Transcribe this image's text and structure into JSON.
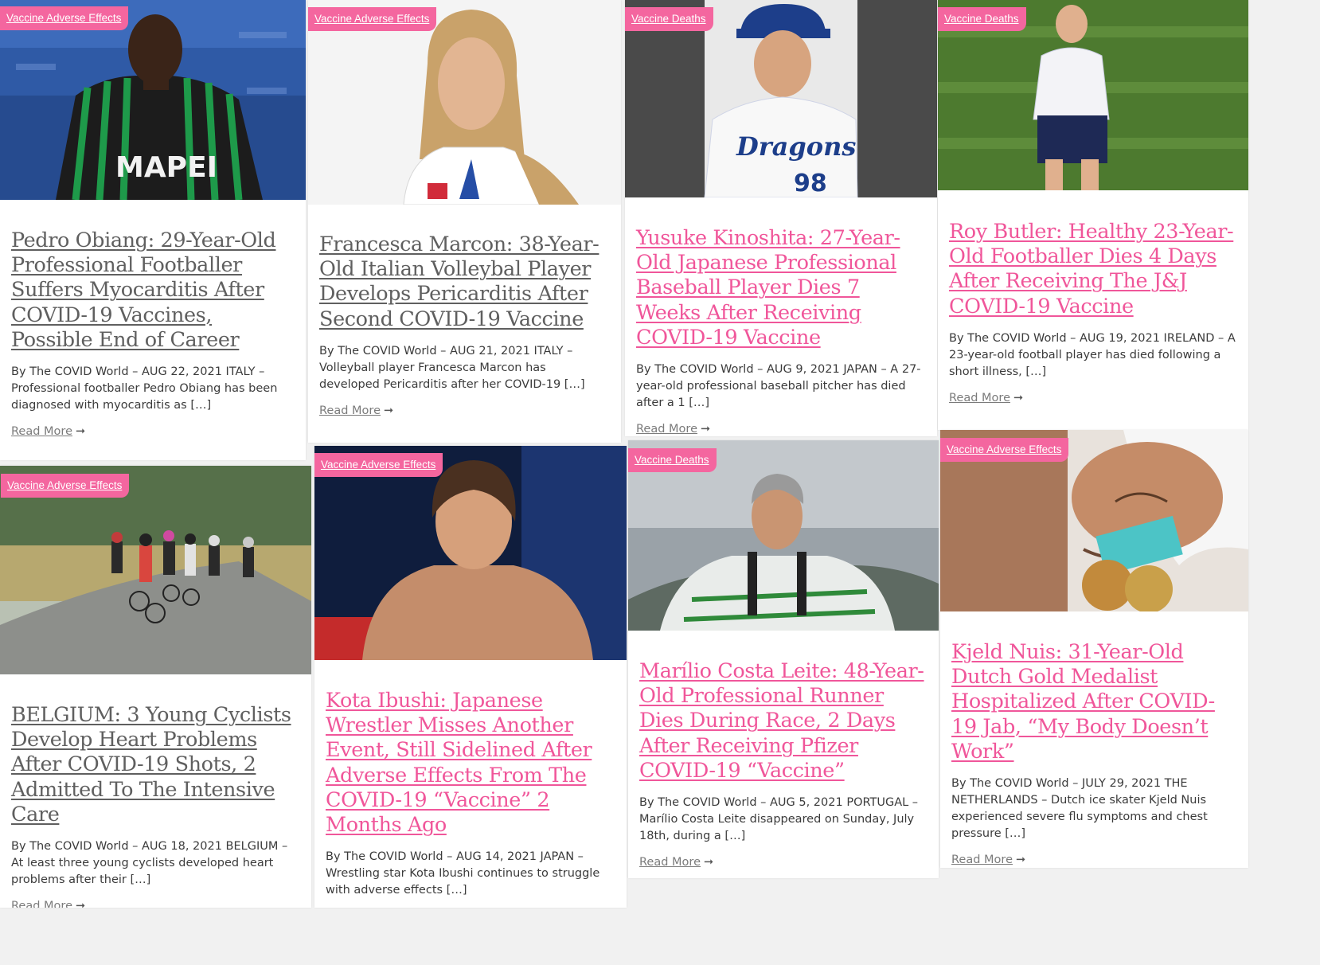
{
  "read_more_label": "Read More",
  "arrow_glyph": "➞",
  "colors": {
    "accent": "#f4669f",
    "title_pink": "#f0569a",
    "title_gray": "#5f5f5f"
  },
  "posts": [
    {
      "category": "Vaccine Adverse Effects",
      "title": "Pedro Obiang: 29-Year-Old Professional Footballer Suffers Myocarditis After COVID-19 Vaccines, Possible End of Career",
      "excerpt": "By The COVID World – AUG 22, 2021 ITALY – Professional footballer Pedro Obiang has been diagnosed with myocarditis as […]"
    },
    {
      "category": "Vaccine Adverse Effects",
      "title": "Francesca Marcon: 38-Year-Old Italian Volleybal Player Develops Pericarditis After Second COVID-19 Vaccine",
      "excerpt": "By The COVID World – AUG 21, 2021 ITALY – Volleyball player Francesca Marcon has developed Pericarditis after her COVID-19 […]"
    },
    {
      "category": "Vaccine Deaths",
      "title": "Yusuke Kinoshita: 27-Year-Old Japanese Professional Baseball Player Dies 7 Weeks After Receiving COVID-19 Vaccine",
      "excerpt": "By The COVID World – AUG 9, 2021 JAPAN – A 27-year-old professional baseball pitcher has died after a 1 […]"
    },
    {
      "category": "Vaccine Deaths",
      "title": "Roy Butler: Healthy 23-Year-Old Footballer Dies 4 Days After Receiving The J&J COVID-19 Vaccine",
      "excerpt": "By The COVID World – AUG 19, 2021 IRELAND – A 23-year-old football player has died following a short illness, […]"
    },
    {
      "category": "Vaccine Adverse Effects",
      "title": "BELGIUM: 3 Young Cyclists Develop Heart Problems After COVID-19 Shots, 2 Admitted To The Intensive Care",
      "excerpt": "By The COVID World – AUG 18, 2021 BELGIUM – At least three young cyclists developed heart problems after their […]"
    },
    {
      "category": "Vaccine Adverse Effects",
      "title": "Kota Ibushi: Japanese Wrestler Misses Another Event, Still Sidelined After Adverse Effects From The COVID-19 “Vaccine” 2 Months Ago",
      "excerpt": "By The COVID World – AUG 14, 2021 JAPAN – Wrestling star Kota Ibushi continues to struggle with adverse effects […]"
    },
    {
      "category": "Vaccine Deaths",
      "title": "Marílio Costa Leite: 48-Year-Old Professional Runner Dies During Race, 2 Days After Receiving Pfizer COVID-19 “Vaccine”",
      "excerpt": "By The COVID World – AUG 5, 2021 PORTUGAL – Marílio Costa Leite disappeared on Sunday, July 18th, during a […]"
    },
    {
      "category": "Vaccine Adverse Effects",
      "title": "Kjeld Nuis: 31-Year-Old Dutch Gold Medalist Hospitalized After COVID-19 Jab, “My Body Doesn’t Work”",
      "excerpt": "By The COVID World – JULY 29, 2021 THE NETHERLANDS – Dutch ice skater Kjeld Nuis experienced severe flu symptoms and chest pressure […]"
    }
  ]
}
